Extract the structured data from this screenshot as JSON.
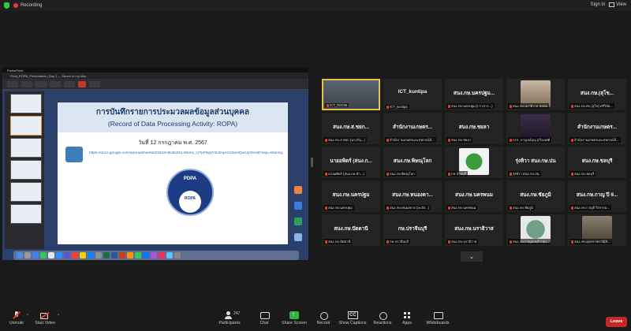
{
  "topbar": {
    "recording_label": "Recording",
    "sign_in_label": "Sign in",
    "view_label": "View"
  },
  "shared_screen": {
    "slide_title_th": "การบันทึกรายการประมวลผลข้อมูลส่วนบุคคล",
    "slide_title_en": "(Record of Data Processing Activity: ROPA)",
    "slide_date": "วันที่ 12 กรกฎาคม พ.ศ. 2567",
    "slide_url": "https://docs.google.com/spreadsheets/d/18oSHkoktzt11-t5bmL_UTpFNgVnKZeqACk3wlJQuiUyO/edit?usp=sharing",
    "circle_title": "PDPA",
    "circle_inner": "ROPA",
    "app_name": "PowerPoint",
    "file_title": "Final_ROPA_Presentation_Day 1 — Saved to my Mac"
  },
  "gallery": {
    "tiles": [
      {
        "name": "",
        "label": "ICT_ROOM",
        "style": "video-room",
        "active": true
      },
      {
        "name": "ICT_kuntipa",
        "label": "ICT_kuntipa",
        "style": "name"
      },
      {
        "name": "สนง.กษ.นครปฐม...",
        "label": "สนง.กษ.นครปฐม (กาวการ...)",
        "style": "name"
      },
      {
        "name": "",
        "label": "สนง.กษ.นราธิวาส ชยพล",
        "style": "video-people"
      },
      {
        "name": "สนง.กษ.(สุโข...",
        "label": "สนง.กษ.ศก.(สุโข) ศรีวิจัย...",
        "style": "name"
      },
      {
        "name": "สนง.กษ.ส.ชยก...",
        "label": "สนง.กษ.ส.ชยก (นางกัน...)",
        "style": "name"
      },
      {
        "name": "สำนักงานเกษตร...",
        "label": "สำนักงานเกษตรและสหกรณ์จั...",
        "style": "name"
      },
      {
        "name": "สนง.กษ.ชยลา",
        "label": "สนง.กษ.ชยลา",
        "style": "name"
      },
      {
        "name": "",
        "label": "กกร. กาญจน์บุญ สุวีรเลศดี",
        "style": "video-cat"
      },
      {
        "name": "สำนักงานเกษตร...",
        "label": "สำนักงานเกษตรและสหกรณ์จั...",
        "style": "name"
      },
      {
        "name": "นายอพิตร์ (สนง.ก...",
        "label": "นายอพิตร์ (สนง.กษ.ชำ...)",
        "style": "name"
      },
      {
        "name": "สนง.กษ.พิษณุโลก",
        "label": "สนง.กษ.พิษณุโลก",
        "style": "name"
      },
      {
        "name": "",
        "label": "กษ.จำนบุรี",
        "style": "logo-green"
      },
      {
        "name": "รุ่งทิวา สนง.กษ.ปน",
        "label": "รุ่งทิวา สนง.กษ.ปน",
        "style": "name"
      },
      {
        "name": "สนง.กษ.ชลบุรี",
        "label": "สนง.กษ.ชลบุรี",
        "style": "name"
      },
      {
        "name": "สนง.กษ.นครปฐม",
        "label": "สนง.กษ.นครปฐม",
        "style": "name"
      },
      {
        "name": "สนง.กษ.หนองคา...",
        "label": "สนง.กษ.หนองคาย (ละอัก...)",
        "style": "name"
      },
      {
        "name": "สนง.กษ.นครพนม",
        "label": "สนง.กษ.นครพนม",
        "style": "name"
      },
      {
        "name": "สนง.กษ.ชัยภูมิ",
        "label": "สนง.กษ.ชัยภูมิ",
        "style": "name"
      },
      {
        "name": "สนง.กษ.กาญ ปี 9...",
        "label": "สนง.กษ.กาญจี วีรกรรม...",
        "style": "name"
      },
      {
        "name": "สนง.กษ.ปัตตานี",
        "label": "สนง.กษ.ปัตตานี",
        "style": "name"
      },
      {
        "name": "กษ.ปราจีนบุรี",
        "label": "กษ.ปราจีนบุรี",
        "style": "name"
      },
      {
        "name": "สนง.กษ.นราธิวาส",
        "label": "สนง.กษ.นราธิวาส",
        "style": "name"
      },
      {
        "name": "",
        "label": "สนง.กษ.กาญจนบุรี กลุ่ม...",
        "style": "logo-seal"
      },
      {
        "name": "",
        "label": "สนง.กษ.อุบลราชธานี(ลิ...",
        "style": "video-person"
      }
    ]
  },
  "toolbar": {
    "unmute": "Unmute",
    "start_video": "Start Video",
    "participants": "Participants",
    "participants_count": "247",
    "chat": "Chat",
    "share_screen": "Share Screen",
    "record": "Record",
    "show_captions": "Show Captions",
    "reactions": "Reactions",
    "apps": "Apps",
    "whiteboards": "Whiteboards",
    "leave": "Leave"
  },
  "colors": {
    "recording": "#e53935",
    "share_green": "#2fb344",
    "leave_red": "#c62828",
    "active_speaker": "#e3c44b"
  }
}
